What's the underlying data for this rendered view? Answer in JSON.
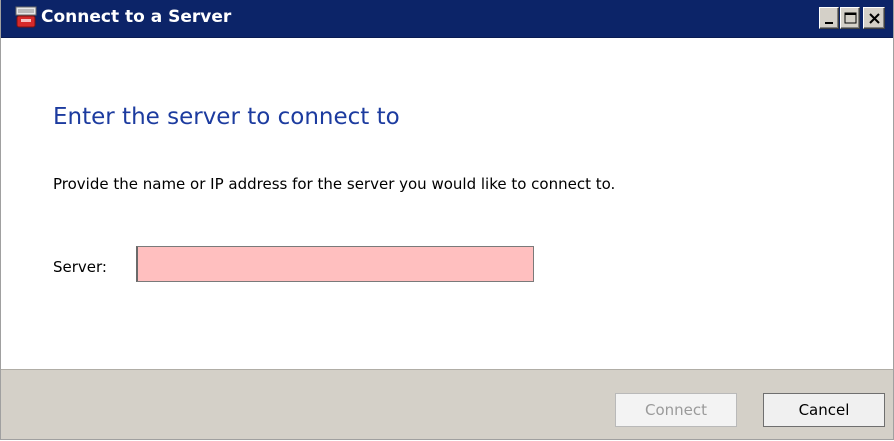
{
  "window": {
    "title": "Connect to a Server",
    "title_icon": "server-connect-icon",
    "controls": [
      "minimize-icon",
      "maximize-icon",
      "close-icon"
    ]
  },
  "main": {
    "heading": "Enter the server to connect to",
    "description": "Provide the name or IP address for the server you would like to connect to.",
    "server_label": "Server:",
    "server_value": "",
    "server_field_color": "#ffbfbf"
  },
  "footer": {
    "connect_label": "Connect",
    "connect_enabled": false,
    "cancel_label": "Cancel"
  },
  "colors": {
    "titlebar": "#0c2468",
    "heading": "#1c3b9f",
    "footer": "#d4d0c8"
  }
}
